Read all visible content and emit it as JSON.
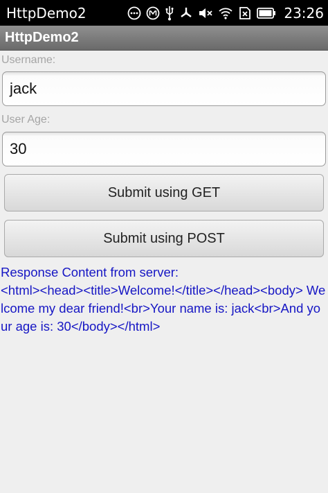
{
  "statusbar": {
    "app_name": "HttpDemo2",
    "time": "23:26",
    "icons": [
      "dots-icon",
      "m-icon",
      "usb-icon",
      "radiation-icon",
      "mute-icon",
      "wifi-icon",
      "no-sim-icon",
      "battery-icon"
    ]
  },
  "titlebar": {
    "title": "HttpDemo2"
  },
  "form": {
    "username_label": "Username:",
    "username_value": "jack",
    "age_label": "User Age:",
    "age_value": "30",
    "get_button": "Submit using GET",
    "post_button": "Submit using POST"
  },
  "response": {
    "text": "Response Content from server:\n<html><head><title>Welcome!</title></head><body> Welcome my dear friend!<br>Your name is: jack<br>And your age is: 30</body></html>"
  },
  "colors": {
    "response_text": "#1616c4",
    "background": "#efefef",
    "label": "#a5a5a5"
  }
}
